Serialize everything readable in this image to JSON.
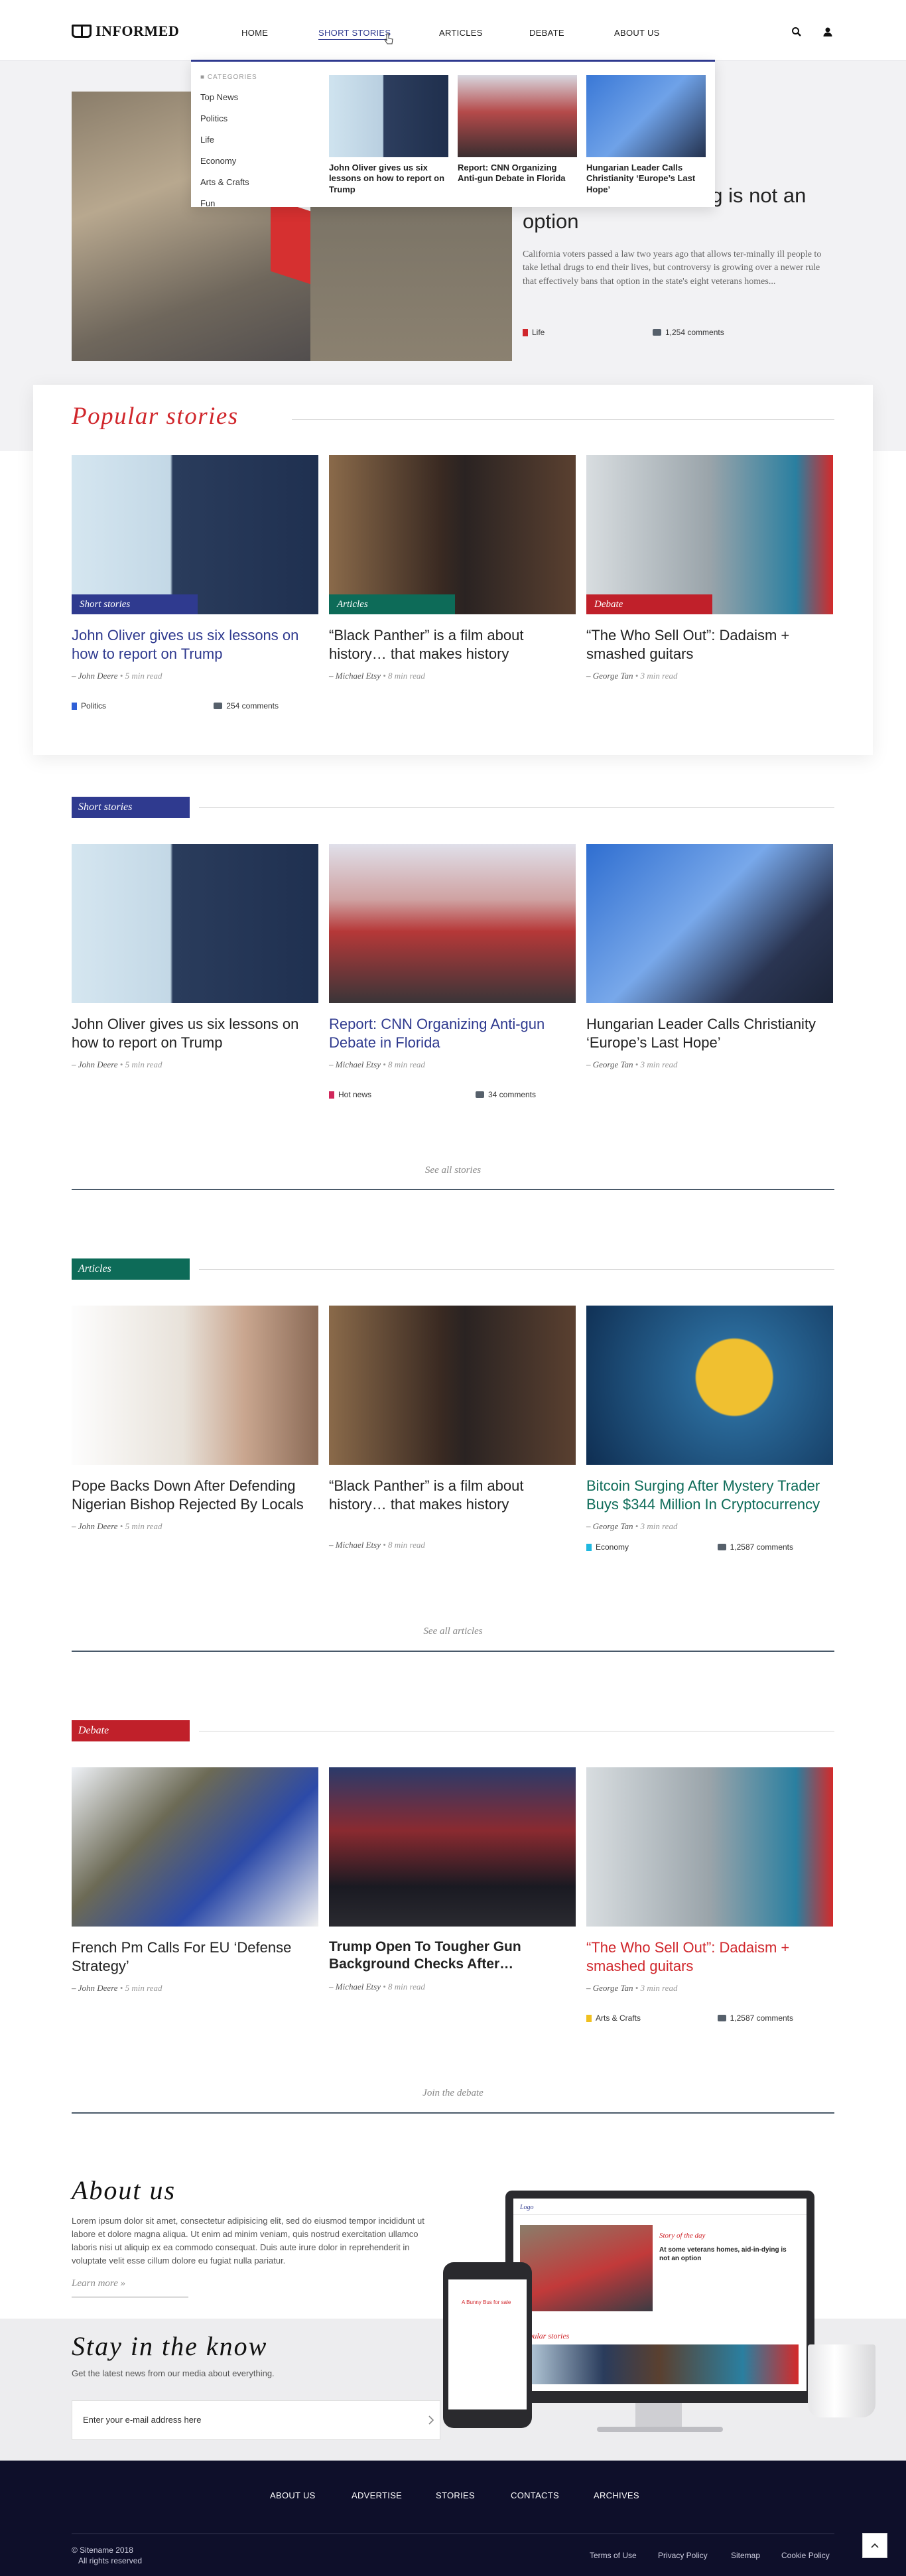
{
  "header": {
    "logo": "INFORMED",
    "nav": [
      "HOME",
      "SHORT STORIES",
      "ARTICLES",
      "DEBATE",
      "ABOUT US"
    ],
    "active_nav": "SHORT STORIES"
  },
  "dropdown": {
    "title": "CATEGORIES",
    "categories": [
      "Top News",
      "Politics",
      "Life",
      "Economy",
      "Arts & Crafts",
      "Fun"
    ],
    "stories": [
      {
        "title": "John Oliver gives us six lessons on how to report on Trump"
      },
      {
        "title": "Report: CNN Organizing Anti-gun Debate in Florida"
      },
      {
        "title": "Hungarian Leader Calls Christianity ‘Europe’s Last Hope’"
      }
    ]
  },
  "hero": {
    "title_visible": "…homes, aid-in-dying is not an option",
    "excerpt": "California voters passed a law two years ago that allows ter-minally ill people to take lethal drugs to end their lives, but controversy is growing over a newer rule that effectively bans that option in the state's eight veterans homes...",
    "category": "Life",
    "comments": "1,254 comments"
  },
  "popular": {
    "title": "Popular stories",
    "cards": [
      {
        "tag": "Short stories",
        "title": "John Oliver gives us six lessons on how to report on Trump",
        "author": "– John Deere",
        "read": " • 5 min read",
        "category": "Politics",
        "comments": "254 comments"
      },
      {
        "tag": "Articles",
        "title": "“Black Panther” is a film about history… that makes history",
        "author": "– Michael Etsy",
        "read": " • 8 min read"
      },
      {
        "tag": "Debate",
        "title": "“The Who Sell Out”: Dadaism + smashed guitars",
        "author": "– George Tan",
        "read": " • 3 min read"
      }
    ]
  },
  "short_stories": {
    "label": "Short stories",
    "cards": [
      {
        "title": "John Oliver gives us six lessons on how to report on Trump",
        "author": "– John Deere",
        "read": " • 5 min read"
      },
      {
        "title": "Report: CNN Organizing Anti-gun Debate in Florida",
        "author": "– Michael Etsy",
        "read": " • 8 min read",
        "category": "Hot news",
        "comments": "34 comments"
      },
      {
        "title": "Hungarian Leader Calls Christianity ‘Europe’s Last Hope’",
        "author": "– George Tan",
        "read": " • 3 min read"
      }
    ],
    "see_all": "See all stories"
  },
  "articles": {
    "label": "Articles",
    "cards": [
      {
        "title": "Pope Backs Down After Defending Nigerian Bishop Rejected By Locals",
        "author": "– John Deere",
        "read": " • 5 min read"
      },
      {
        "title": "“Black Panther” is a film about history… that makes history",
        "author": "– Michael Etsy",
        "read": " • 8 min read"
      },
      {
        "title": "Bitcoin Surging After Mystery Trader Buys $344 Million In Cryptocurrency",
        "author": "– George Tan",
        "read": " • 3 min read",
        "category": "Economy",
        "comments": "1,2587 comments"
      }
    ],
    "see_all": "See all articles"
  },
  "debate": {
    "label": "Debate",
    "cards": [
      {
        "title": "French Pm Calls For EU ‘Defense Strategy’",
        "author": "– John Deere",
        "read": " • 5 min read"
      },
      {
        "title": "Trump Open To Tougher Gun Background Checks After…",
        "author": "– Michael Etsy",
        "read": " • 8 min read"
      },
      {
        "title": "“The Who Sell Out”: Dadaism + smashed guitars",
        "author": "– George Tan",
        "read": " • 3 min read",
        "category": "Arts & Crafts",
        "comments": "1,2587 comments"
      }
    ],
    "see_all": "Join the debate"
  },
  "about": {
    "title": "About us",
    "text": "Lorem ipsum dolor sit amet, consectetur adipisicing elit, sed do eiusmod tempor incididunt ut labore et dolore magna aliqua. Ut enim ad minim veniam, quis nostrud exercitation ullamco laboris nisi ut aliquip ex ea commodo consequat. Duis aute irure dolor in reprehenderit in voluptate velit esse cillum dolore eu fugiat nulla pariatur.",
    "learn_more": "Learn more »"
  },
  "stay": {
    "title": "Stay in the know",
    "subtitle": "Get the latest news from our media about everything.",
    "email_placeholder": "Enter your e-mail address here"
  },
  "mockup": {
    "logo": "Logo",
    "story_label": "Story of the day",
    "story_title": "At some veterans homes, aid-in-dying is not an option",
    "popular": "Popular stories",
    "phone_story": "A Bunny Bus for sale"
  },
  "footer": {
    "nav": [
      "ABOUT US",
      "ADVERTISE",
      "STORIES",
      "CONTACTS",
      "ARCHIVES"
    ],
    "copyright": "© Sitename 2018",
    "rights": "All rights reserved",
    "links": [
      "Terms of Use",
      "Privacy Policy",
      "Sitemap",
      "Cookie Policy"
    ]
  },
  "colors": {
    "accent": "#2f3a8f",
    "red": "#d0262b",
    "green": "#0d6b58",
    "dark": "#0e0f2a"
  }
}
